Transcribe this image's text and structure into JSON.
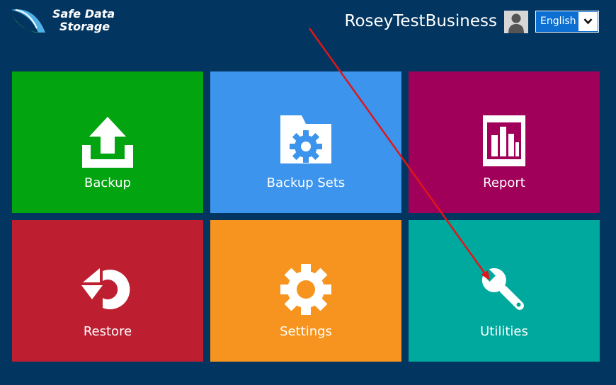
{
  "brand": {
    "line1": "Safe Data",
    "line2": "Storage"
  },
  "header": {
    "user_name": "RoseyTestBusiness"
  },
  "language": {
    "selected": "English"
  },
  "tiles": [
    {
      "label": "Backup",
      "icon": "upload-icon",
      "color": "#02a40f"
    },
    {
      "label": "Backup Sets",
      "icon": "folder-gear-icon",
      "color": "#3c94ec"
    },
    {
      "label": "Report",
      "icon": "bar-chart-icon",
      "color": "#a0005a"
    },
    {
      "label": "Restore",
      "icon": "restore-icon",
      "color": "#bd1f31"
    },
    {
      "label": "Settings",
      "icon": "gear-icon",
      "color": "#f7941f"
    },
    {
      "label": "Utilities",
      "icon": "wrench-icon",
      "color": "#00a99d"
    }
  ],
  "colors": {
    "background": "#02355f",
    "annotation_arrow": "#e0161b"
  }
}
